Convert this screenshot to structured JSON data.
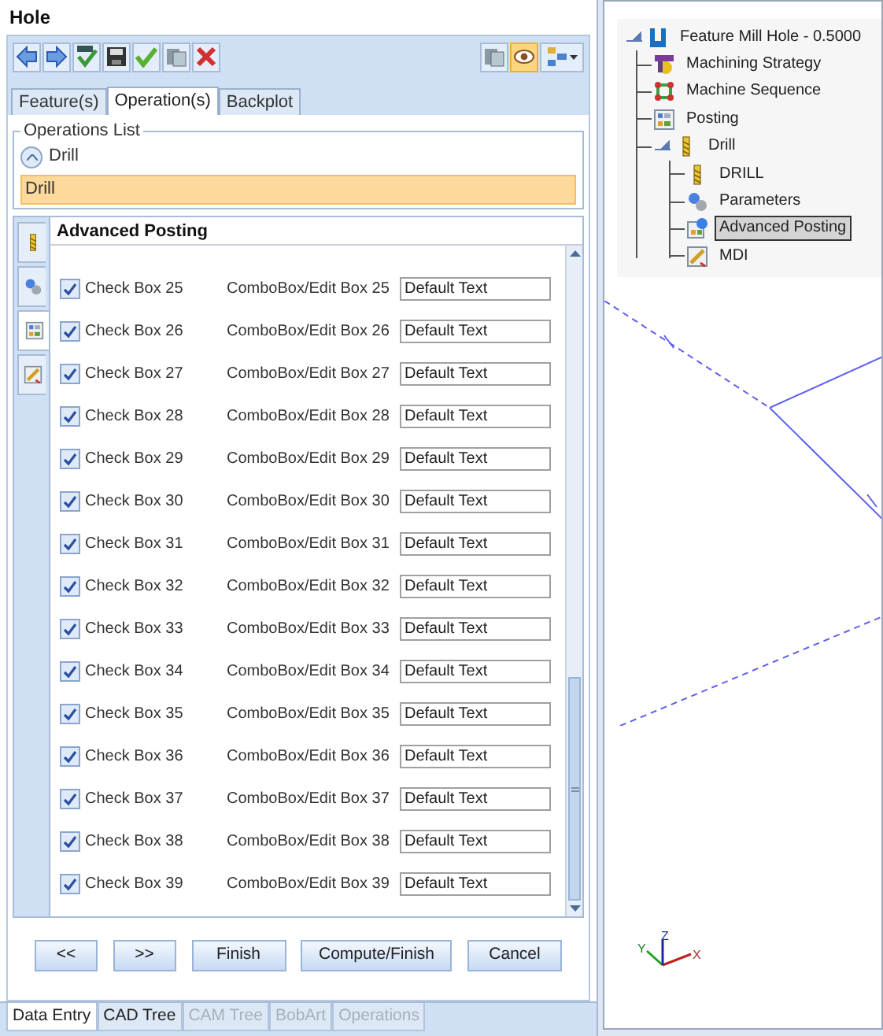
{
  "window": {
    "title": "Hole"
  },
  "toolbar": {
    "left": [
      {
        "kind": "back"
      },
      {
        "kind": "forward"
      },
      {
        "kind": "all"
      },
      {
        "kind": "save"
      },
      {
        "kind": "ok"
      },
      {
        "kind": "stack"
      },
      {
        "kind": "cancel"
      }
    ],
    "right": [
      {
        "kind": "stack",
        "pressed": false
      },
      {
        "kind": "eye",
        "pressed": true
      },
      {
        "kind": "layout",
        "pressed": false
      }
    ]
  },
  "tabs": [
    {
      "label": "Feature(s)",
      "selected": false
    },
    {
      "label": "Operation(s)",
      "selected": true
    },
    {
      "label": "Backplot",
      "selected": false
    }
  ],
  "operations_list": {
    "title": "Operations List",
    "group": "Drill",
    "expanded": true,
    "items": [
      {
        "label": "Drill",
        "selected": true
      }
    ]
  },
  "panel": {
    "title": "Advanced Posting",
    "side_tabs": [
      {
        "kind": "drill",
        "selected": false
      },
      {
        "kind": "parameters",
        "selected": false
      },
      {
        "kind": "posting",
        "selected": true
      },
      {
        "kind": "mdi",
        "selected": false
      }
    ],
    "rows": [
      {
        "check_label": "Check Box 25",
        "checked": true,
        "combo_label": "ComboBox/Edit Box 25",
        "value": "Default Text"
      },
      {
        "check_label": "Check Box 26",
        "checked": true,
        "combo_label": "ComboBox/Edit Box 26",
        "value": "Default Text"
      },
      {
        "check_label": "Check Box 27",
        "checked": true,
        "combo_label": "ComboBox/Edit Box 27",
        "value": "Default Text"
      },
      {
        "check_label": "Check Box 28",
        "checked": true,
        "combo_label": "ComboBox/Edit Box 28",
        "value": "Default Text"
      },
      {
        "check_label": "Check Box 29",
        "checked": true,
        "combo_label": "ComboBox/Edit Box 29",
        "value": "Default Text"
      },
      {
        "check_label": "Check Box 30",
        "checked": true,
        "combo_label": "ComboBox/Edit Box 30",
        "value": "Default Text"
      },
      {
        "check_label": "Check Box 31",
        "checked": true,
        "combo_label": "ComboBox/Edit Box 31",
        "value": "Default Text"
      },
      {
        "check_label": "Check Box 32",
        "checked": true,
        "combo_label": "ComboBox/Edit Box 32",
        "value": "Default Text"
      },
      {
        "check_label": "Check Box 33",
        "checked": true,
        "combo_label": "ComboBox/Edit Box 33",
        "value": "Default Text"
      },
      {
        "check_label": "Check Box 34",
        "checked": true,
        "combo_label": "ComboBox/Edit Box 34",
        "value": "Default Text"
      },
      {
        "check_label": "Check Box 35",
        "checked": true,
        "combo_label": "ComboBox/Edit Box 35",
        "value": "Default Text"
      },
      {
        "check_label": "Check Box 36",
        "checked": true,
        "combo_label": "ComboBox/Edit Box 36",
        "value": "Default Text"
      },
      {
        "check_label": "Check Box 37",
        "checked": true,
        "combo_label": "ComboBox/Edit Box 37",
        "value": "Default Text"
      },
      {
        "check_label": "Check Box 38",
        "checked": true,
        "combo_label": "ComboBox/Edit Box 38",
        "value": "Default Text"
      },
      {
        "check_label": "Check Box 39",
        "checked": true,
        "combo_label": "ComboBox/Edit Box 39",
        "value": "Default Text"
      }
    ]
  },
  "buttons": [
    "<<",
    ">>",
    "Finish",
    "Compute/Finish",
    "Cancel"
  ],
  "bottom_tabs": [
    {
      "label": "Data Entry",
      "selected": true,
      "disabled": false
    },
    {
      "label": "CAD Tree",
      "selected": false,
      "disabled": false
    },
    {
      "label": "CAM Tree",
      "selected": false,
      "disabled": true
    },
    {
      "label": "BobArt",
      "selected": false,
      "disabled": true
    },
    {
      "label": "Operations",
      "selected": false,
      "disabled": true
    }
  ],
  "tree": [
    {
      "label": "Feature Mill Hole - 0.5000",
      "kind": "feature",
      "selected": false,
      "expanded": true,
      "children": [
        {
          "label": "Machining Strategy",
          "kind": "strategy",
          "selected": false
        },
        {
          "label": "Machine Sequence",
          "kind": "sequence",
          "selected": false
        },
        {
          "label": "Posting",
          "kind": "posting",
          "selected": false
        },
        {
          "label": "Drill",
          "kind": "drill",
          "selected": false,
          "expanded": true,
          "children": [
            {
              "label": "DRILL",
              "kind": "drill",
              "selected": false
            },
            {
              "label": "Parameters",
              "kind": "parameters",
              "selected": false
            },
            {
              "label": "Advanced Posting",
              "kind": "advposting",
              "selected": true
            },
            {
              "label": "MDI",
              "kind": "mdi",
              "selected": false
            }
          ]
        }
      ]
    }
  ],
  "axes": [
    "X",
    "Y",
    "Z"
  ]
}
